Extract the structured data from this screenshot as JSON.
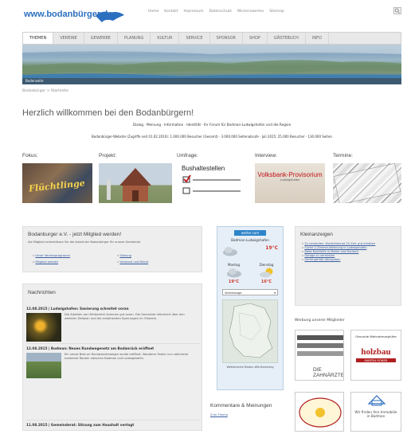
{
  "header": {
    "logo": "www.bodanbürger.de",
    "topnav": [
      "Home",
      "Kontakt",
      "Impressum",
      "Datenschutz",
      "Wissenswertes",
      "Sitemap"
    ]
  },
  "mainnav": [
    "THEMEN",
    "VEREINE",
    "GEWERBE",
    "PLANUNG",
    "KULTUR",
    "SERVICE",
    "SPONSOR",
    "SHOP",
    "GÄSTEBUCH",
    "INFO"
  ],
  "banner": {
    "caption": "Bodenseite"
  },
  "breadcrumb": "Bodanbürger > Startseite",
  "welcome": {
    "title": "Herzlich willkommen bei den Bodanbürgern!",
    "links_line": "Dialog · Meinung · Information · Identität · Ihr Forum für Bodman-Ludwigshafen und die Region",
    "stats_line": "Bodanbürger-Website (Zugriffe seit 01.02.2010): 1.000.000 Besucher (Gesamt) · 3.000.000 Seitenabrufe · Juli 2015: 25.000 Besucher · 130.000 Seiten"
  },
  "features": [
    {
      "label": "Fokus:",
      "img_text": "Flüchtlinge"
    },
    {
      "label": "Projekt:"
    },
    {
      "label": "Umfrage:",
      "img_text": "Bushaltestellen"
    },
    {
      "label": "Interview:",
      "img_text": "Volksbank-Provisorium",
      "img_sub": "Ludwigshafen"
    },
    {
      "label": "Termine:"
    }
  ],
  "membership": {
    "title": "Bodanburger e.V. - jetzt Mitglied werden!",
    "intro": "Als Mitglied unterstützen Sie die Arbeit der Bodanbürger für unsere Gemeinde.",
    "links": [
      "Unser Vereinsprogramm",
      "Mitglied werden",
      "Satzung",
      "Vorstand und Beirat"
    ]
  },
  "news": {
    "title": "Nachrichten",
    "items": [
      {
        "head": "12.08.2015 | Ludwigshafen: Sanierung schreitet voran",
        "body": "Die Arbeiten am Uferbereich kommen gut voran. Die Gemeinde informiert über den weiteren Zeitplan und die anstehenden Sperrungen im Ortskern."
      },
      {
        "head": "12.08.2015 | Bodman: Neues Rundwegenetz am Bodanrück eröffnet",
        "body": "Ein neues Netz an Rundwanderwegen wurde eröffnet. Wanderer finden nun zahlreiche markierte Routen zwischen Bodman und Ludwigshafen."
      },
      {
        "head": "11.08.2015 | Gemeinderat: Sitzung zum Haushalt vertagt",
        "body": ""
      }
    ]
  },
  "weather": {
    "banner": "wetter.com",
    "location": "Bodman-Ludwigshafen",
    "temp_now": "19°C",
    "days": [
      {
        "label": "Montag",
        "temp": "19°C"
      },
      {
        "label": "Dienstag",
        "temp": "16°C"
      }
    ],
    "select": "Vorhersage",
    "map_caption": "Wetterkarte Baden-Württemberg"
  },
  "comments": {
    "title": "Kommentare & Meinungen",
    "first": "Zum Thema"
  },
  "classifieds": {
    "title": "Kleinanzeigen",
    "items": [
      "Zu verkaufen: Kinderfahrrad 20 Zoll, gut erhalten",
      "Suche 2-Zimmer-Wohnung in Ludwigshafen",
      "Biete Nachhilfe in Mathe und Deutsch",
      "Garage zu vermieten",
      "Gartengeräte abzugeben"
    ]
  },
  "sponsors": {
    "title": "Werbung unserer Mitglieder",
    "items": [
      {
        "name": "DIE ZAHNÄRZTE"
      },
      {
        "name": "holzbau",
        "sub": "MARTIN RÖBER",
        "top": "Gesunde Wohnatmosphäre"
      },
      {
        "name": "Sonnen-Apotheke"
      },
      {
        "name": "Wir finden Ihre Immobilie in Bodman"
      }
    ]
  },
  "colors": {
    "brand": "#2c6fbf",
    "nav_bg": "#e8e8e8",
    "link": "#3a5fa0"
  }
}
